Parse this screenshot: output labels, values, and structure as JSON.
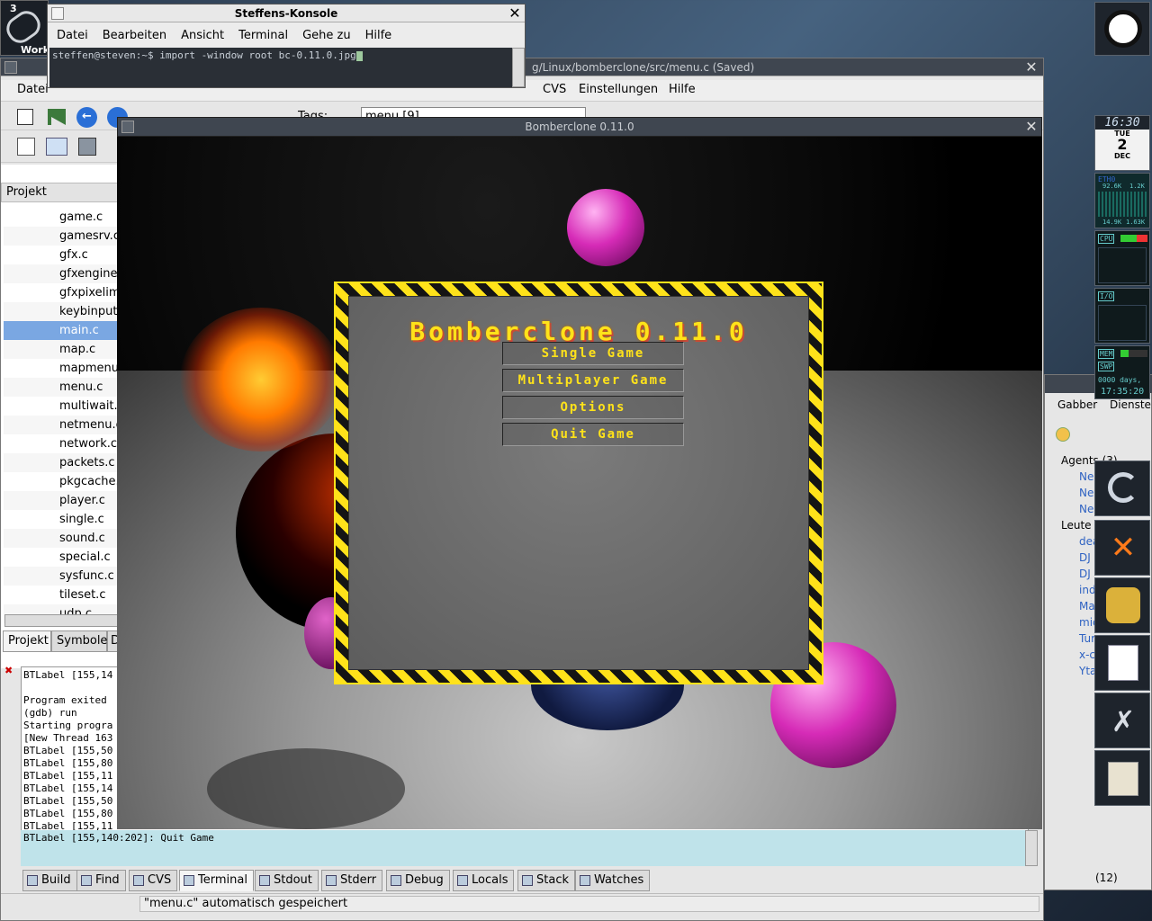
{
  "konsole": {
    "title": "Steffens-Konsole",
    "menu": [
      "Datei",
      "Bearbeiten",
      "Ansicht",
      "Terminal",
      "Gehe zu",
      "Hilfe"
    ],
    "prompt": "steffen@steven:~$ import -window root bc-0.11.0.jpg"
  },
  "workspace": {
    "number": "3",
    "label": "Work"
  },
  "ide": {
    "title": "g/Linux/bomberclone/src/menu.c (Saved)",
    "menu_left": "Datei",
    "menu_right": [
      "CVS",
      "Einstellungen",
      "Hilfe"
    ],
    "tags_label": "Tags:",
    "tags_value": "menu [9]",
    "project_header": "Projekt",
    "files": [
      "game.c",
      "gamesrv.c",
      "gfx.c",
      "gfxengine.c",
      "gfxpixelimage.c",
      "keybinput.c",
      "main.c",
      "map.c",
      "mapmenu.c",
      "menu.c",
      "multiwait.c",
      "netmenu.c",
      "network.c",
      "packets.c",
      "pkgcache.c",
      "player.c",
      "single.c",
      "sound.c",
      "special.c",
      "sysfunc.c",
      "tileset.c",
      "udp.c"
    ],
    "selected_file": "main.c",
    "left_tabs": [
      "Projekt",
      "Symbole",
      "D"
    ],
    "output_lines": [
      "BTLabel [155,14",
      "",
      "Program exited",
      "(gdb) run",
      "Starting progra",
      "[New Thread 163",
      "BTLabel [155,50",
      "BTLabel [155,80",
      "BTLabel [155,11",
      "BTLabel [155,14",
      "BTLabel [155,50",
      "BTLabel [155,80",
      "BTLabel [155,11"
    ],
    "output_last": "BTLabel [155,140:202]: Quit Game",
    "bottom_tabs": [
      "Build",
      "Find",
      "CVS",
      "Terminal",
      "Stdout",
      "Stderr",
      "Debug",
      "Locals",
      "Stack",
      "Watches"
    ],
    "active_tab": "Terminal",
    "status": "\"menu.c\" automatisch gespeichert"
  },
  "game": {
    "window_title": "Bomberclone 0.11.0",
    "logo": "Bomberclone 0.11.0",
    "buttons": [
      "Single Game",
      "Multiplayer Game",
      "Options",
      "Quit Game"
    ]
  },
  "dock": {
    "clock": "16:30",
    "day": "TUE",
    "date": "2",
    "month": "DEC",
    "net_label": "ETH0",
    "net_rx": "92.6K",
    "net_tx": "1.2K",
    "net_rx2": "14.9K",
    "net_tx2": "1.63K",
    "cpu_label": "CPU",
    "io_label": "I/O",
    "mem_label": "MEM",
    "swp_label": "SWP",
    "uptime_days": "0000 days,",
    "uptime_time": "17:35:20"
  },
  "gabber": {
    "tabs": [
      "Gabber",
      "Dienste"
    ],
    "agents_header": "Agents (3)",
    "agents": [
      "Ne",
      "Ne",
      "Ne"
    ],
    "people_header": "Leute (",
    "people": [
      "dea",
      "DJ",
      "DJ",
      "ind",
      "Ma",
      "mic",
      "Tur",
      "x-c",
      "Yta"
    ],
    "count": "(12)"
  },
  "colors": {
    "accent": "#ffe21a",
    "selection": "#7aa7e2",
    "terminal_bg": "#bfe3ea"
  }
}
